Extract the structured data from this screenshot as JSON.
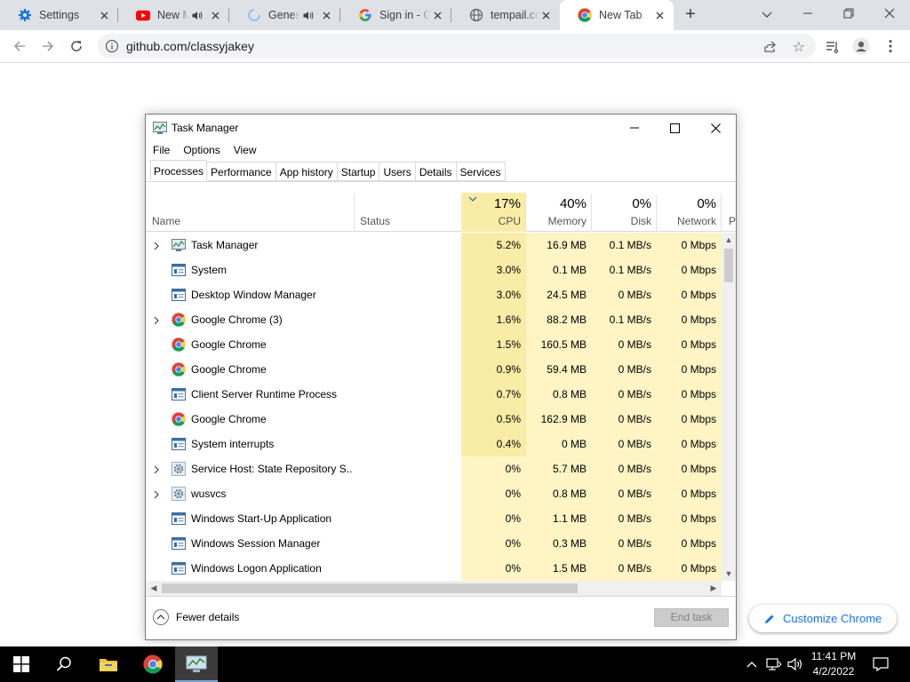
{
  "browser": {
    "tabs": [
      {
        "title": "Settings",
        "icon": "settings-gear-icon",
        "audio": false,
        "active": false
      },
      {
        "title": "New M",
        "icon": "youtube-icon",
        "audio": true,
        "active": false
      },
      {
        "title": "Genesi",
        "icon": "loading-spinner-icon",
        "audio": true,
        "active": false
      },
      {
        "title": "Sign in - G",
        "icon": "google-icon",
        "audio": false,
        "active": false
      },
      {
        "title": "tempail.cor",
        "icon": "globe-icon",
        "audio": false,
        "active": false
      },
      {
        "title": "New Tab",
        "icon": "chrome-icon",
        "audio": false,
        "active": true
      }
    ],
    "new_tab_symbol": "+",
    "url": "github.com/classyjakey",
    "customize_label": "Customize Chrome"
  },
  "task_manager": {
    "title": "Task Manager",
    "menu": [
      "File",
      "Options",
      "View"
    ],
    "tabs": [
      "Processes",
      "Performance",
      "App history",
      "Startup",
      "Users",
      "Details",
      "Services"
    ],
    "selected_tab": "Processes",
    "columns": {
      "name": "Name",
      "status": "Status",
      "cpu": {
        "percent": "17%",
        "label": "CPU"
      },
      "memory": {
        "percent": "40%",
        "label": "Memory"
      },
      "disk": {
        "percent": "0%",
        "label": "Disk"
      },
      "network": {
        "percent": "0%",
        "label": "Network"
      },
      "next": "P"
    },
    "processes": [
      {
        "name": "Task Manager",
        "icon": "task-manager-icon",
        "expandable": true,
        "cpu": "5.2%",
        "memory": "16.9 MB",
        "disk": "0.1 MB/s",
        "network": "0 Mbps"
      },
      {
        "name": "System",
        "icon": "system-window-icon",
        "expandable": false,
        "cpu": "3.0%",
        "memory": "0.1 MB",
        "disk": "0.1 MB/s",
        "network": "0 Mbps"
      },
      {
        "name": "Desktop Window Manager",
        "icon": "system-window-icon",
        "expandable": false,
        "cpu": "3.0%",
        "memory": "24.5 MB",
        "disk": "0 MB/s",
        "network": "0 Mbps"
      },
      {
        "name": "Google Chrome (3)",
        "icon": "chrome-icon",
        "expandable": true,
        "cpu": "1.6%",
        "memory": "88.2 MB",
        "disk": "0.1 MB/s",
        "network": "0 Mbps"
      },
      {
        "name": "Google Chrome",
        "icon": "chrome-icon",
        "expandable": false,
        "cpu": "1.5%",
        "memory": "160.5 MB",
        "disk": "0 MB/s",
        "network": "0 Mbps"
      },
      {
        "name": "Google Chrome",
        "icon": "chrome-icon",
        "expandable": false,
        "cpu": "0.9%",
        "memory": "59.4 MB",
        "disk": "0 MB/s",
        "network": "0 Mbps"
      },
      {
        "name": "Client Server Runtime Process",
        "icon": "system-window-icon",
        "expandable": false,
        "cpu": "0.7%",
        "memory": "0.8 MB",
        "disk": "0 MB/s",
        "network": "0 Mbps"
      },
      {
        "name": "Google Chrome",
        "icon": "chrome-icon",
        "expandable": false,
        "cpu": "0.5%",
        "memory": "162.9 MB",
        "disk": "0 MB/s",
        "network": "0 Mbps"
      },
      {
        "name": "System interrupts",
        "icon": "system-window-icon",
        "expandable": false,
        "cpu": "0.4%",
        "memory": "0 MB",
        "disk": "0 MB/s",
        "network": "0 Mbps"
      },
      {
        "name": "Service Host: State Repository S...",
        "icon": "service-gear-icon",
        "expandable": true,
        "cpu": "0%",
        "memory": "5.7 MB",
        "disk": "0 MB/s",
        "network": "0 Mbps"
      },
      {
        "name": "wusvcs",
        "icon": "service-gear-icon",
        "expandable": true,
        "cpu": "0%",
        "memory": "0.8 MB",
        "disk": "0 MB/s",
        "network": "0 Mbps"
      },
      {
        "name": "Windows Start-Up Application",
        "icon": "system-window-icon",
        "expandable": false,
        "cpu": "0%",
        "memory": "1.1 MB",
        "disk": "0 MB/s",
        "network": "0 Mbps"
      },
      {
        "name": "Windows Session Manager",
        "icon": "system-window-icon",
        "expandable": false,
        "cpu": "0%",
        "memory": "0.3 MB",
        "disk": "0 MB/s",
        "network": "0 Mbps"
      },
      {
        "name": "Windows Logon Application",
        "icon": "system-window-icon",
        "expandable": false,
        "cpu": "0%",
        "memory": "1.5 MB",
        "disk": "0 MB/s",
        "network": "0 Mbps"
      }
    ],
    "fewer_details_label": "Fewer details",
    "end_task_label": "End task"
  },
  "taskbar": {
    "time": "11:41 PM",
    "date": "4/2/2022"
  },
  "colors": {
    "chrome_tabstrip": "#dee1e6",
    "cpu_highlight": "#f9eca6",
    "cell_highlight": "#fff4c4",
    "accent_blue": "#1a73e8"
  }
}
